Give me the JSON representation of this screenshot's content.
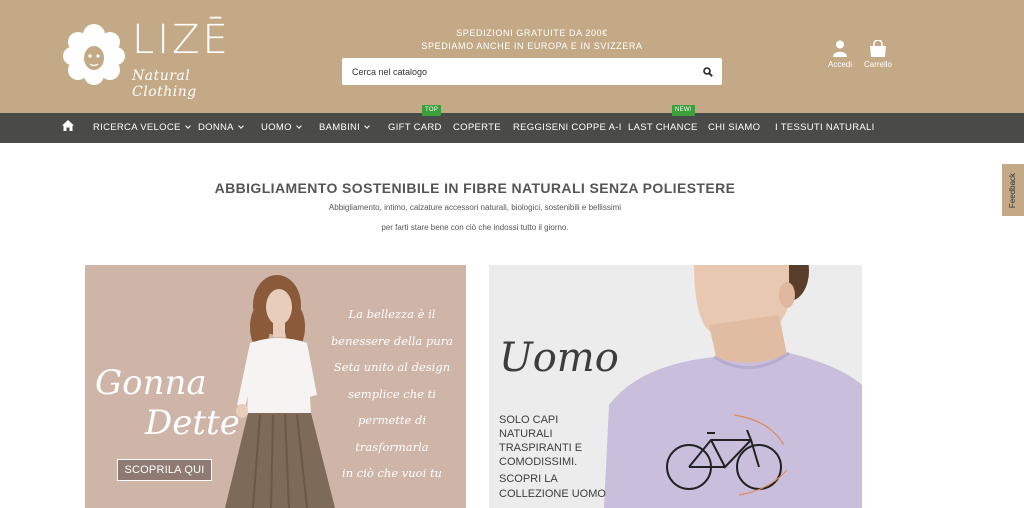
{
  "colors": {
    "header_bg": "#c3a985",
    "nav_bg": "#4a4a48",
    "badge": "#3aa13a"
  },
  "brand": {
    "name": "LIZĒ",
    "tagline": "Natural Clothing"
  },
  "promo": {
    "line1": "SPEDIZIONI GRATUITE DA 200€",
    "line2": "SPEDIAMO ANCHE IN EUROPA E IN SVIZZERA"
  },
  "search": {
    "placeholder": "Cerca nel catalogo",
    "icon": "search-icon"
  },
  "account": {
    "accedi": "Accedi",
    "carrello": "Carrello"
  },
  "nav": {
    "home_icon": "home-icon",
    "items": [
      {
        "label": "RICERCA VELOCE"
      },
      {
        "label": "DONNA"
      },
      {
        "label": "UOMO"
      },
      {
        "label": "BAMBINI"
      },
      {
        "label": "GIFT CARD",
        "badge": "TOP"
      },
      {
        "label": "COPERTE"
      },
      {
        "label": "REGGISENI COPPE A-I"
      },
      {
        "label": "LAST CHANCE",
        "badge": "NEW!"
      },
      {
        "label": "CHI SIAMO"
      },
      {
        "label": "I TESSUTI NATURALI"
      }
    ]
  },
  "intro": {
    "title": "ABBIGLIAMENTO SOSTENIBILE IN FIBRE NATURALI SENZA POLIESTERE",
    "line1": "Abbigliamento, intimo, calzature accessori naturali, biologici, sostenibili e bellissimi",
    "line2": "per farti stare bene con ciò che indossi tutto il giorno."
  },
  "feedback": "Feedback",
  "banner_women": {
    "title_line1": "Gonna",
    "title_line2": "Dette",
    "button": "SCOPRILA QUI",
    "quote": [
      "La bellezza è il",
      "benessere della pura",
      "Seta unito al design",
      "semplice che ti",
      "permette di",
      "trasformarla",
      "in ciò che vuoi tu"
    ]
  },
  "banner_men": {
    "title": "Uomo",
    "text": [
      "SOLO CAPI NATURALI",
      "TRASPIRANTI E",
      "COMODISSIMI."
    ],
    "cta": [
      "SCOPRI LA",
      "COLLEZIONE UOMO"
    ]
  }
}
